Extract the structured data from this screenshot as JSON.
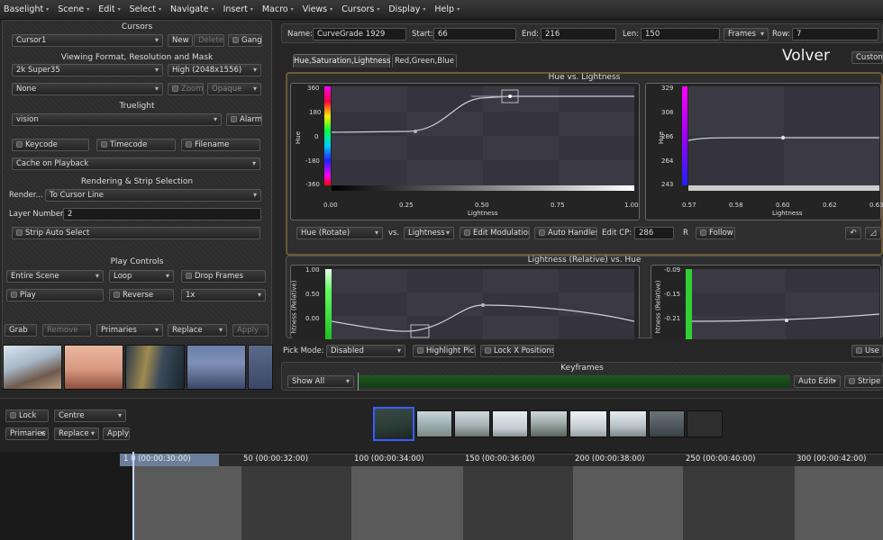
{
  "menubar": [
    "Baselight",
    "Scene",
    "Edit",
    "Select",
    "Navigate",
    "Insert",
    "Macro",
    "Views",
    "Cursors",
    "Display",
    "Help"
  ],
  "left": {
    "cursors": {
      "title": "Cursors",
      "current": "Cursor1",
      "new": "New",
      "delete": "Delete",
      "gang": "Gang"
    },
    "viewing": {
      "title": "Viewing Format,  Resolution and Mask",
      "format": "2k Super35",
      "resolution": "High (2048x1556)",
      "mask": "None",
      "zoom": "Zoom",
      "opaque": "Opaque"
    },
    "truelight": {
      "title": "Truelight",
      "value": "vision",
      "alarm": "Alarm"
    },
    "overlays": {
      "keycode": "Keycode",
      "timecode": "Timecode",
      "filename": "Filename",
      "cache": "Cache on Playback"
    },
    "render": {
      "title": "Rendering & Strip Selection",
      "render_label": "Render...",
      "render_value": "To Cursor Line",
      "layer_label": "Layer Number:",
      "layer_value": "2",
      "strip": "Strip Auto Select"
    },
    "play": {
      "title": "Play Controls",
      "scope": "Entire Scene",
      "mode": "Loop",
      "drop": "Drop Frames",
      "play": "Play",
      "reverse": "Reverse",
      "speed": "1x"
    },
    "gallery": {
      "grab": "Grab",
      "remove": "Remove",
      "primaries": "Primaries",
      "replace": "Replace",
      "apply": "Apply"
    }
  },
  "header": {
    "name_label": "Name:",
    "name": "CurveGrade 1929",
    "start_label": "Start:",
    "start": "66",
    "end_label": "End:",
    "end": "216",
    "len_label": "Len:",
    "len": "150",
    "units": "Frames",
    "row_label": "Row:",
    "row": "7"
  },
  "tabs": [
    "Hue,Saturation,Lightness",
    "Red,Green,Blue"
  ],
  "overlay_text": "Volver",
  "custom_btn": "Customi",
  "graph1": {
    "title": "Hue vs. Lightness",
    "ylabel": "Hue",
    "xlabel": "Lightness",
    "yticks": [
      "360",
      "180",
      "0",
      "-180",
      "-360"
    ],
    "xticks": [
      "0.00",
      "0.25",
      "0.50",
      "0.75",
      "1.00"
    ],
    "side_yticks": [
      "329",
      "308",
      "286",
      "264",
      "243"
    ],
    "side_xticks": [
      "0.57",
      "0.58",
      "0.60",
      "0.62",
      "0.63"
    ],
    "side_xlabel": "Lightness",
    "side_ylabel": "Hue"
  },
  "curve_controls": {
    "channel": "Hue (Rotate)",
    "vs": "vs.",
    "axis": "Lightness",
    "edit_mod": "Edit Modulation",
    "auto_handles": "Auto Handles",
    "edit_cp_label": "Edit CP:",
    "edit_cp": "286",
    "r_label": "R",
    "follow": "Follow"
  },
  "graph2": {
    "title": "Lightness (Relative) vs. Hue",
    "ylabel": "htness (Relative)",
    "yticks": [
      "1.00",
      "0.50",
      "0.00"
    ],
    "side_yticks": [
      "-0.09",
      "-0.15",
      "-0.21"
    ],
    "side_ylabel": "htness (Relative)"
  },
  "pick": {
    "label": "Pick Mode:",
    "mode": "Disabled",
    "highlight": "Highlight Pick",
    "lockx": "Lock X Positions",
    "use": "Use M"
  },
  "keyframes": {
    "title": "Keyframes",
    "show": "Show All",
    "auto_edit": "Auto Edit",
    "stripe": "Stripe"
  },
  "timeline": {
    "lock": "Lock",
    "centre": "Centre",
    "primaries": "Primaries",
    "replace": "Replace",
    "apply": "Apply",
    "ticks": [
      "1 0 (00:00:30:00)",
      "50 (00:00:32:00)",
      "100 (00:00:34:00)",
      "150 (00:00:36:00)",
      "200 (00:00:38:00)",
      "250 (00:00:40:00)",
      "300 (00:00:42:00)"
    ]
  },
  "colors": {
    "accent": "#3a5cff",
    "timeline_highlight": "#6b7f9a",
    "keyframe_bar": "#1f5a1f"
  }
}
